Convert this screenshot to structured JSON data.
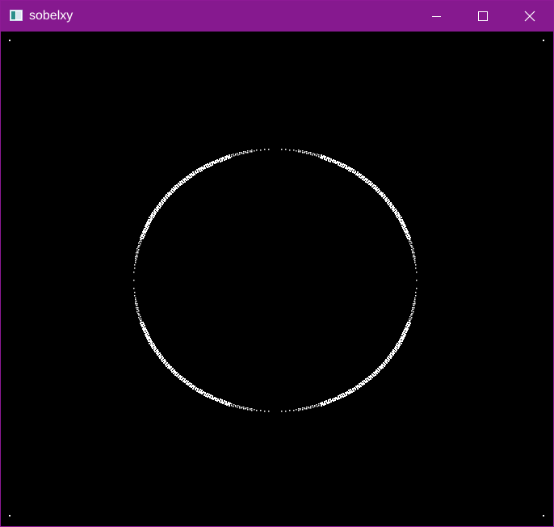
{
  "window": {
    "title": "sobelxy",
    "app_icon": "image-window-icon",
    "controls": {
      "minimize_icon": "minimize-icon",
      "maximize_icon": "maximize-icon",
      "close_icon": "close-icon"
    }
  },
  "colors": {
    "titlebar_background": "#86198f",
    "title_text": "#ffffff",
    "image_background": "#000000",
    "edge_pixels": "#ffffff"
  },
  "image": {
    "content": "edge-detected-circle",
    "icon": "edge-image"
  }
}
